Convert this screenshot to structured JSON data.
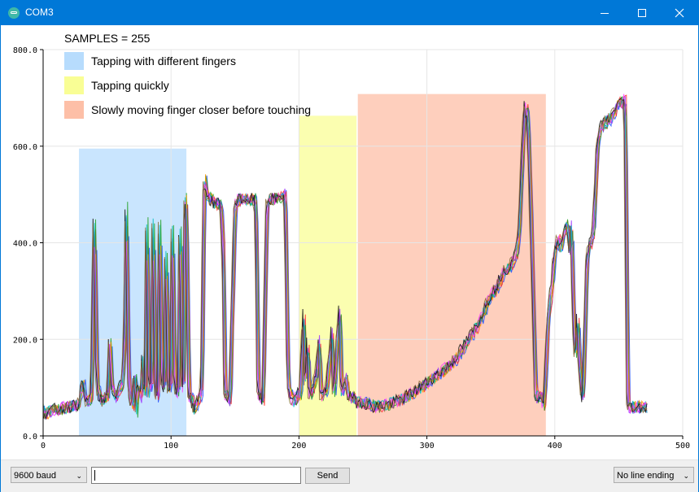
{
  "window": {
    "title": "COM3",
    "minimize_icon": "minimize-icon",
    "maximize_icon": "maximize-icon",
    "close_icon": "close-icon"
  },
  "toolbar": {
    "baud_rate": "9600 baud",
    "message_input_value": "",
    "send_label": "Send",
    "line_ending": "No line ending"
  },
  "chart_data": {
    "type": "line",
    "title": "",
    "xlabel": "",
    "ylabel": "",
    "xlim": [
      0,
      500
    ],
    "ylim": [
      0,
      800
    ],
    "x_ticks": [
      "0",
      "100",
      "200",
      "300",
      "400",
      "500"
    ],
    "y_ticks": [
      "0.0",
      "200.0",
      "400.0",
      "600.0",
      "800.0"
    ],
    "grid": true,
    "annotation": "SAMPLES = 255",
    "x_end": 472,
    "series_colors": [
      "#1f4fff",
      "#ff3030",
      "#20a020",
      "#ff9900",
      "#9b30ff",
      "#00c0c0",
      "#ff40ff",
      "#101010",
      "#8a6d3b"
    ],
    "series_count": 9,
    "profile": [
      [
        0,
        45
      ],
      [
        10,
        55
      ],
      [
        20,
        60
      ],
      [
        28,
        65
      ],
      [
        31,
        110
      ],
      [
        34,
        70
      ],
      [
        38,
        80
      ],
      [
        40,
        470
      ],
      [
        42,
        120
      ],
      [
        44,
        80
      ],
      [
        47,
        70
      ],
      [
        51,
        90
      ],
      [
        52,
        210
      ],
      [
        54,
        100
      ],
      [
        57,
        80
      ],
      [
        62,
        110
      ],
      [
        64,
        210
      ],
      [
        65,
        500
      ],
      [
        67,
        100
      ],
      [
        70,
        60
      ],
      [
        72,
        140
      ],
      [
        73,
        40
      ],
      [
        74,
        100
      ],
      [
        77,
        80
      ],
      [
        78,
        170
      ],
      [
        79,
        80
      ],
      [
        80,
        110
      ],
      [
        81,
        475
      ],
      [
        83,
        90
      ],
      [
        85,
        110
      ],
      [
        86,
        475
      ],
      [
        88,
        80
      ],
      [
        90,
        90
      ],
      [
        91,
        470
      ],
      [
        93,
        120
      ],
      [
        95,
        100
      ],
      [
        96,
        400
      ],
      [
        98,
        100
      ],
      [
        100,
        100
      ],
      [
        101,
        460
      ],
      [
        103,
        100
      ],
      [
        106,
        90
      ],
      [
        107,
        460
      ],
      [
        109,
        100
      ],
      [
        110,
        100
      ],
      [
        111,
        500
      ],
      [
        112,
        480
      ],
      [
        114,
        80
      ],
      [
        116,
        80
      ],
      [
        118,
        55
      ],
      [
        121,
        75
      ],
      [
        124,
        90
      ],
      [
        126,
        540
      ],
      [
        128,
        500
      ],
      [
        131,
        490
      ],
      [
        135,
        480
      ],
      [
        139,
        480
      ],
      [
        141,
        380
      ],
      [
        142,
        90
      ],
      [
        146,
        70
      ],
      [
        150,
        480
      ],
      [
        153,
        490
      ],
      [
        158,
        490
      ],
      [
        162,
        490
      ],
      [
        166,
        490
      ],
      [
        167,
        380
      ],
      [
        168,
        90
      ],
      [
        172,
        70
      ],
      [
        175,
        480
      ],
      [
        177,
        490
      ],
      [
        182,
        490
      ],
      [
        186,
        495
      ],
      [
        189,
        500
      ],
      [
        190,
        400
      ],
      [
        191,
        180
      ],
      [
        192,
        90
      ],
      [
        196,
        70
      ],
      [
        198,
        80
      ],
      [
        200,
        90
      ],
      [
        201,
        80
      ],
      [
        204,
        260
      ],
      [
        205,
        100
      ],
      [
        207,
        200
      ],
      [
        208,
        80
      ],
      [
        210,
        90
      ],
      [
        214,
        130
      ],
      [
        216,
        210
      ],
      [
        217,
        80
      ],
      [
        220,
        90
      ],
      [
        222,
        100
      ],
      [
        226,
        220
      ],
      [
        227,
        80
      ],
      [
        232,
        270
      ],
      [
        233,
        90
      ],
      [
        237,
        120
      ],
      [
        239,
        80
      ],
      [
        243,
        80
      ],
      [
        245,
        70
      ],
      [
        250,
        70
      ],
      [
        260,
        60
      ],
      [
        270,
        65
      ],
      [
        280,
        75
      ],
      [
        290,
        90
      ],
      [
        300,
        110
      ],
      [
        310,
        130
      ],
      [
        320,
        150
      ],
      [
        330,
        190
      ],
      [
        340,
        230
      ],
      [
        350,
        290
      ],
      [
        355,
        310
      ],
      [
        360,
        340
      ],
      [
        365,
        350
      ],
      [
        368,
        370
      ],
      [
        370,
        380
      ],
      [
        372,
        420
      ],
      [
        373,
        480
      ],
      [
        375,
        600
      ],
      [
        377,
        690
      ],
      [
        379,
        650
      ],
      [
        380,
        580
      ],
      [
        382,
        400
      ],
      [
        384,
        200
      ],
      [
        385,
        80
      ],
      [
        388,
        80
      ],
      [
        390,
        80
      ],
      [
        391,
        60
      ],
      [
        392,
        80
      ],
      [
        395,
        250
      ],
      [
        398,
        320
      ],
      [
        400,
        380
      ],
      [
        403,
        410
      ],
      [
        405,
        390
      ],
      [
        408,
        430
      ],
      [
        410,
        440
      ],
      [
        412,
        380
      ],
      [
        413,
        450
      ],
      [
        414,
        320
      ],
      [
        415,
        220
      ],
      [
        416,
        170
      ],
      [
        417,
        180
      ],
      [
        418,
        250
      ],
      [
        419,
        160
      ],
      [
        420,
        130
      ],
      [
        421,
        90
      ],
      [
        422,
        80
      ],
      [
        424,
        250
      ],
      [
        425,
        350
      ],
      [
        426,
        380
      ],
      [
        428,
        400
      ],
      [
        430,
        420
      ],
      [
        432,
        520
      ],
      [
        433,
        580
      ],
      [
        434,
        620
      ],
      [
        436,
        640
      ],
      [
        440,
        650
      ],
      [
        445,
        660
      ],
      [
        448,
        680
      ],
      [
        450,
        690
      ],
      [
        453,
        690
      ],
      [
        455,
        700
      ],
      [
        456,
        400
      ],
      [
        457,
        60
      ],
      [
        460,
        60
      ],
      [
        465,
        60
      ],
      [
        470,
        60
      ],
      [
        472,
        60
      ]
    ]
  },
  "legend": {
    "samples_label": "SAMPLES = 255",
    "items": [
      {
        "label": "Tapping with different fingers",
        "color": "#b7dcfd"
      },
      {
        "label": "Tapping quickly",
        "color": "#f9fe95"
      },
      {
        "label": "Slowly moving finger closer before touching",
        "color": "#fdbfa7"
      }
    ]
  }
}
